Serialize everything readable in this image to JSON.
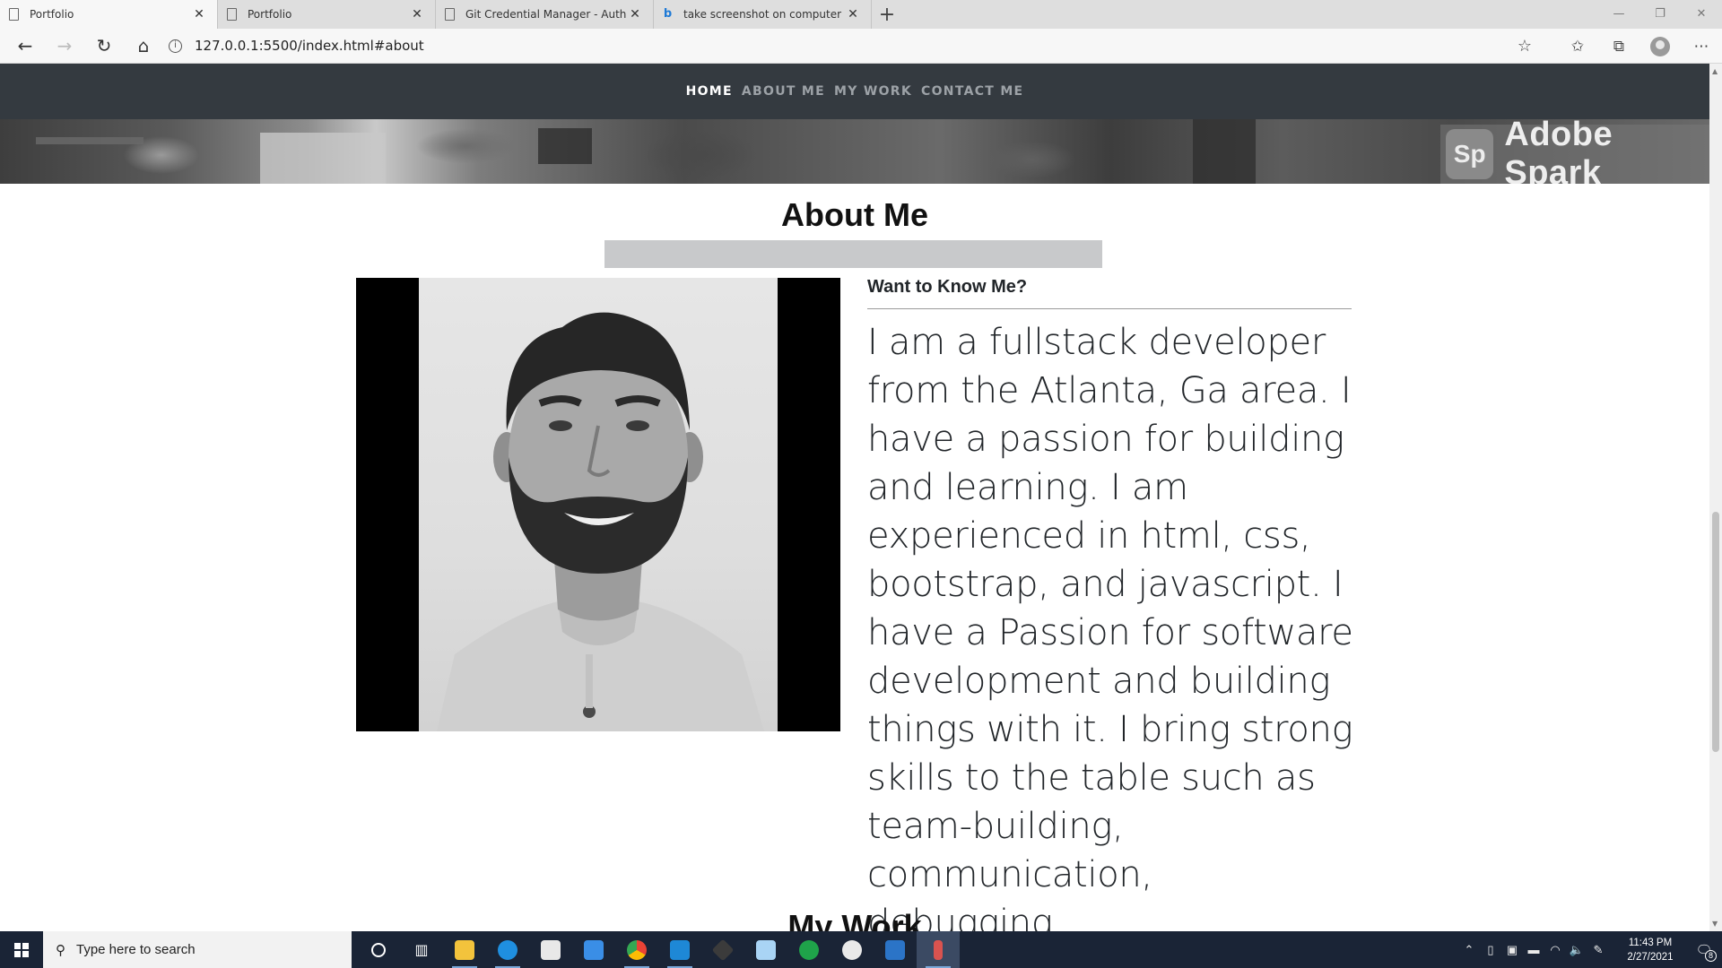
{
  "browser": {
    "tabs": [
      {
        "title": "Portfolio",
        "icon": "page-icon",
        "active": true
      },
      {
        "title": "Portfolio",
        "icon": "page-icon",
        "active": false
      },
      {
        "title": "Git Credential Manager - Authen",
        "icon": "page-icon",
        "active": false
      },
      {
        "title": "take screenshot on computer - B",
        "icon": "bing-icon",
        "active": false
      }
    ],
    "new_tab": "+",
    "url": "127.0.0.1:5500/index.html#about"
  },
  "site": {
    "nav": [
      {
        "label": "HOME",
        "active": true
      },
      {
        "label": "ABOUT ME",
        "active": false
      },
      {
        "label": "MY WORK",
        "active": false
      },
      {
        "label": "CONTACT ME",
        "active": false
      }
    ],
    "banner_watermark": {
      "logo": "Sp",
      "text": "Adobe Spark"
    },
    "about": {
      "title": "About Me",
      "subheading": "Want to Know Me?",
      "bio": "I am a fullstack developer from the Atlanta, Ga area. I have a passion for building and learning. I am experienced in html, css, bootstrap, and javascript. I have a Passion for software development and building things with it. I bring strong skills to the table such as team-building, communication, debugging."
    },
    "next_section_title": "My Work"
  },
  "taskbar": {
    "search_placeholder": "Type here to search",
    "time": "11:43 PM",
    "date": "2/27/2021",
    "notifications": "8"
  },
  "colors": {
    "nav_bg": "#343a40",
    "nav_active": "#ffffff",
    "nav_inactive": "#9da2a7",
    "divider_bar": "#c8c9cb",
    "taskbar_bg": "#1a2436"
  }
}
